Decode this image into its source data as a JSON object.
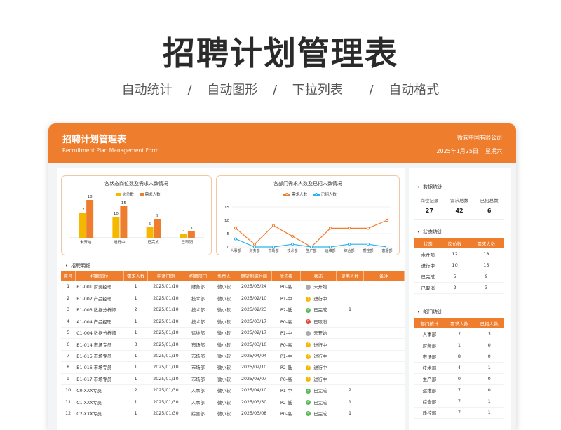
{
  "hero": {
    "title": "招聘计划管理表",
    "features": [
      "自动统计",
      "/",
      "自动图形",
      "/",
      "下拉列表",
      "/",
      "自动格式"
    ]
  },
  "header": {
    "title": "招聘计划管理表",
    "subtitle": "Recruitment Plan Management Form",
    "company": "微软中国有限公司",
    "date": "2025年1月25日",
    "weekday": "星期六"
  },
  "colors": {
    "accent": "#ef7d2e",
    "yellow": "#f5b800",
    "blue": "#29b3e8",
    "green": "#5cb85c",
    "red": "#e04b3a",
    "gray": "#aaaaaa"
  },
  "chart_data": [
    {
      "type": "bar",
      "title": "各状态岗位数及需求人数情况",
      "categories": [
        "未开始",
        "进行中",
        "已完成",
        "已取消"
      ],
      "series": [
        {
          "name": "岗位数",
          "values": [
            12,
            10,
            5,
            2
          ]
        },
        {
          "name": "需求人数",
          "values": [
            18,
            15,
            9,
            3
          ]
        }
      ],
      "ylim": [
        0,
        20
      ]
    },
    {
      "type": "line",
      "title": "各部门需求人数及已招人数情况",
      "categories": [
        "人事部",
        "财务部",
        "市场部",
        "技术部",
        "生产部",
        "运维部",
        "综合部",
        "质控部",
        "客服部"
      ],
      "series": [
        {
          "name": "需求人数",
          "values": [
            7,
            1,
            8,
            4,
            0,
            7,
            7,
            7,
            10
          ]
        },
        {
          "name": "已招人数",
          "values": [
            3,
            0,
            0,
            1,
            0,
            0,
            1,
            1,
            0
          ]
        }
      ],
      "yticks": [
        "0",
        "5",
        "10",
        "15"
      ],
      "ylim": [
        0,
        15
      ]
    }
  ],
  "detail": {
    "label": "招聘明细",
    "columns": [
      "序号",
      "招聘岗位",
      "需求人数",
      "申请日期",
      "招聘部门",
      "负责人",
      "期望到岗时间",
      "优先级",
      "状态",
      "录用人数",
      "备注"
    ],
    "rows": [
      [
        "1",
        "B1-001 财务经理",
        "1",
        "2025/01/10",
        "财务部",
        "微小软",
        "2025/03/24",
        "P0-高",
        "未开始",
        "",
        ""
      ],
      [
        "2",
        "B1-002 产品经理",
        "1",
        "2025/01/10",
        "技术部",
        "微小软",
        "2025/02/10",
        "P1-中",
        "进行中",
        "",
        ""
      ],
      [
        "3",
        "B1-003 数据分析师",
        "2",
        "2025/01/10",
        "技术部",
        "微小软",
        "2025/02/23",
        "P2-低",
        "已完成",
        "1",
        ""
      ],
      [
        "4",
        "A1-004 产品经理",
        "1",
        "2025/01/10",
        "技术部",
        "微小软",
        "2025/03/17",
        "P0-高",
        "已取消",
        "",
        ""
      ],
      [
        "5",
        "C1-004 数据分析师",
        "1",
        "2025/01/10",
        "运维部",
        "微小软",
        "2025/02/17",
        "P1-中",
        "未开始",
        "",
        ""
      ],
      [
        "6",
        "B1-014 市场专员",
        "3",
        "2025/01/10",
        "市场部",
        "微小软",
        "2025/03/10",
        "P0-高",
        "进行中",
        "",
        ""
      ],
      [
        "7",
        "B1-015 市场专员",
        "1",
        "2025/01/10",
        "市场部",
        "微小软",
        "2025/04/04",
        "P1-中",
        "进行中",
        "",
        ""
      ],
      [
        "8",
        "B1-016 市场专员",
        "1",
        "2025/01/10",
        "市场部",
        "微小软",
        "2025/02/10",
        "P2-低",
        "进行中",
        "",
        ""
      ],
      [
        "9",
        "B1-017 市场专员",
        "1",
        "2025/01/10",
        "市场部",
        "微小软",
        "2025/03/07",
        "P0-高",
        "进行中",
        "",
        ""
      ],
      [
        "10",
        "C0-XXX专员",
        "2",
        "2025/01/30",
        "人事部",
        "微小软",
        "2025/04/10",
        "P1-中",
        "已完成",
        "2",
        ""
      ],
      [
        "11",
        "C1-XXX专员",
        "1",
        "2025/01/30",
        "人事部",
        "微小软",
        "2025/03/30",
        "P2-低",
        "已完成",
        "1",
        ""
      ],
      [
        "12",
        "C2-XXX专员",
        "1",
        "2025/01/30",
        "综合部",
        "微小软",
        "2025/03/08",
        "P0-高",
        "已完成",
        "1",
        ""
      ]
    ]
  },
  "side": {
    "data_stats": {
      "label": "数据统计",
      "labels": [
        "岗位记录",
        "需求总数",
        "已招总数"
      ],
      "values": [
        "27",
        "42",
        "6"
      ]
    },
    "status_stats": {
      "label": "状态统计",
      "columns": [
        "状态",
        "岗位数",
        "需求人数"
      ],
      "rows": [
        [
          "未开始",
          "12",
          "18"
        ],
        [
          "进行中",
          "10",
          "15"
        ],
        [
          "已完成",
          "5",
          "9"
        ],
        [
          "已取消",
          "2",
          "3"
        ]
      ]
    },
    "dept_stats": {
      "label": "部门统计",
      "columns": [
        "部门统计",
        "需求人数",
        "已招人数"
      ],
      "rows": [
        [
          "人事部",
          "7",
          "3"
        ],
        [
          "财务部",
          "1",
          "0"
        ],
        [
          "市场部",
          "8",
          "0"
        ],
        [
          "技术部",
          "4",
          "1"
        ],
        [
          "生产部",
          "0",
          "0"
        ],
        [
          "运维部",
          "7",
          "0"
        ],
        [
          "综合部",
          "7",
          "1"
        ],
        [
          "质控部",
          "7",
          "1"
        ]
      ]
    }
  }
}
